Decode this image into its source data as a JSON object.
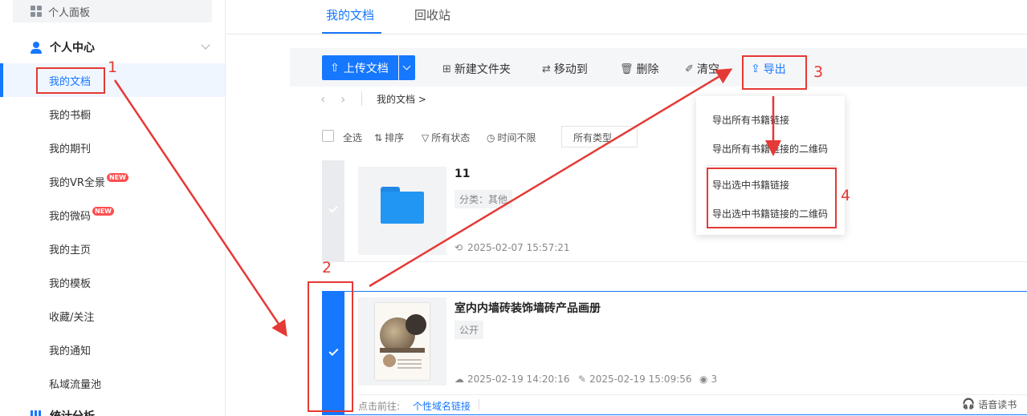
{
  "sidebar": {
    "panel_label": "个人面板",
    "group_label": "个人中心",
    "items": [
      {
        "label": "我的文档"
      },
      {
        "label": "我的书橱"
      },
      {
        "label": "我的期刊"
      },
      {
        "label": "我的VR全景",
        "badge": "NEW"
      },
      {
        "label": "我的微码",
        "badge": "NEW"
      },
      {
        "label": "我的主页"
      },
      {
        "label": "我的模板"
      },
      {
        "label": "收藏/关注"
      },
      {
        "label": "我的通知"
      },
      {
        "label": "私域流量池"
      }
    ],
    "bottom_group_label": "统计分析"
  },
  "tabs": [
    {
      "label": "我的文档",
      "active": true
    },
    {
      "label": "回收站",
      "active": false
    }
  ],
  "toolbar": {
    "upload_label": "上传文档",
    "new_folder_label": "新建文件夹",
    "move_label": "移动到",
    "delete_label": "删除",
    "clear_label": "清空",
    "export_label": "导出"
  },
  "breadcrumb": {
    "path": "我的文档 >"
  },
  "filters": {
    "select_all": "全选",
    "sort": "排序",
    "status": "所有状态",
    "time": "时间不限",
    "type": "所有类型"
  },
  "rows": [
    {
      "title": "11",
      "tag": "分类：其他",
      "modified": "2025-02-07 15:57:21",
      "selected": false
    },
    {
      "title": "室内内墙砖装饰墙砖产品画册",
      "tag": "公开",
      "uploaded": "2025-02-19 14:20:16",
      "modified": "2025-02-19 15:09:56",
      "views": "3",
      "selected": true,
      "footer_label": "点击前往:",
      "footer_link": "个性域名链接",
      "voice_label": "语音读书"
    }
  ],
  "export_menu": [
    {
      "label": "导出所有书籍链接"
    },
    {
      "label": "导出所有书籍链接的二维码"
    },
    {
      "label": "导出选中书籍链接"
    },
    {
      "label": "导出选中书籍链接的二维码"
    }
  ],
  "annotations": [
    "1",
    "2",
    "3",
    "4"
  ],
  "colors": {
    "accent": "#1677ff",
    "annotation": "#e53935"
  }
}
